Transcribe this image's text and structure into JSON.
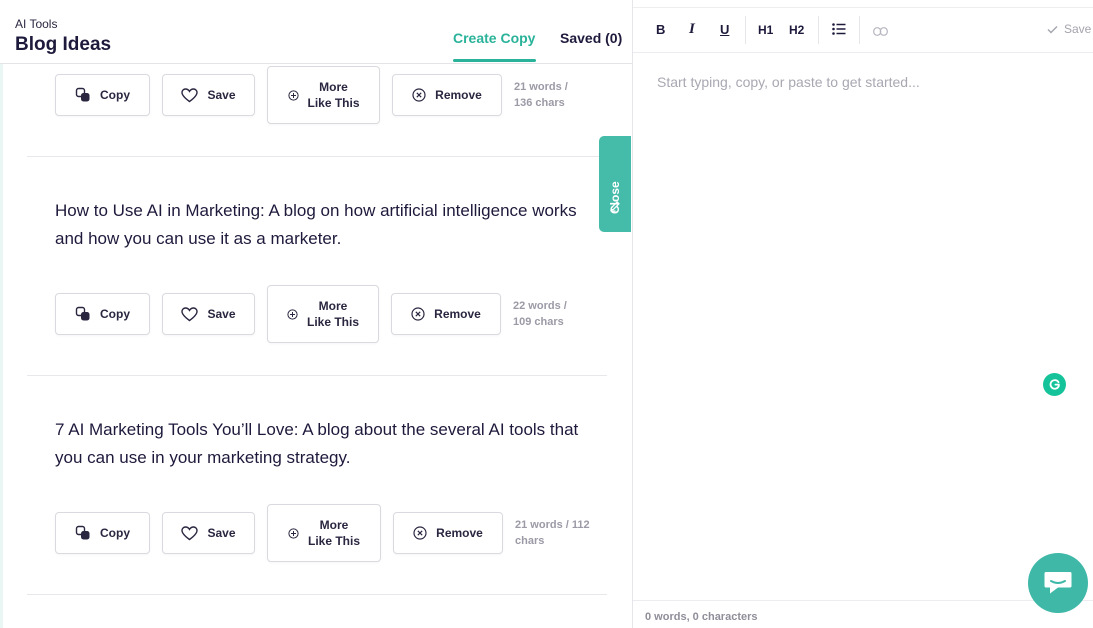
{
  "header": {
    "breadcrumb": "AI Tools",
    "title": "Blog Ideas",
    "tabs": [
      {
        "label": "Create Copy"
      },
      {
        "label": "Saved (0)"
      }
    ]
  },
  "buttons": {
    "copy": "Copy",
    "save": "Save",
    "more_line1": "More",
    "more_line2": "Like This",
    "remove": "Remove"
  },
  "results": [
    {
      "text": "",
      "meta_line1": "21 words /",
      "meta_line2": "136 chars"
    },
    {
      "text": "How to Use AI in Marketing: A blog on how artificial intelligence works and how you can use it as a marketer.",
      "meta_line1": "22 words /",
      "meta_line2": "109 chars"
    },
    {
      "text": "7 AI Marketing Tools You’ll Love: A blog about the several AI tools that you can use in your marketing strategy.",
      "meta_line1": "21 words / 112",
      "meta_line2": "chars"
    }
  ],
  "side_tab": {
    "label": "Close"
  },
  "editor": {
    "toolbar": {
      "bold": "B",
      "italic": "I",
      "underline": "U",
      "h1": "H1",
      "h2": "H2",
      "save": "Save"
    },
    "placeholder": "Start typing, copy, or paste to get started...",
    "counter": "0 words, 0 characters"
  },
  "colors": {
    "accent": "#2ab39a",
    "side_tab": "#45bba9",
    "grammarly": "#15c39a",
    "chat": "#3fb8a8"
  }
}
